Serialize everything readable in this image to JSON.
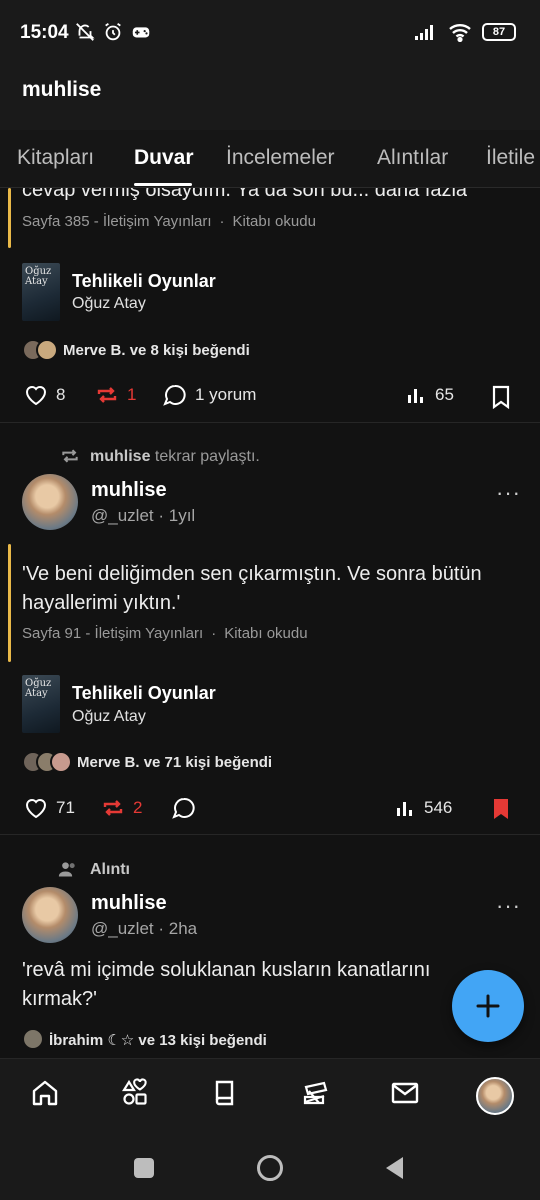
{
  "status_bar": {
    "time": "15:04",
    "battery": "87"
  },
  "app_bar": {
    "title": "muhlise"
  },
  "tabs": [
    {
      "label": "Kitapları"
    },
    {
      "label": "Duvar"
    },
    {
      "label": "İncelemeler"
    },
    {
      "label": "Alıntılar"
    },
    {
      "label": "İletile"
    }
  ],
  "posts": [
    {
      "quote_tail": "cevap vermiş olsaydım. Ya da son bu... daha fazla",
      "page_ref": "Sayfa 385 - İletişim Yayınları",
      "status": "Kitabı okudu",
      "book": {
        "title": "Tehlikeli Oyunlar",
        "author": "Oğuz Atay",
        "cover_line1": "Oğuz",
        "cover_line2": "Atay"
      },
      "likes_text": "Merve B. ve 8 kişi beğendi",
      "actions": {
        "likes": "8",
        "reposts": "1",
        "comments": "1 yorum",
        "views": "65"
      }
    },
    {
      "repost_user": "muhlise",
      "repost_label": "tekrar paylaştı.",
      "user": {
        "name": "muhlise",
        "handle": "@_uzlet",
        "time": "1yıl"
      },
      "quote": "'Ve beni deliğimden sen çıkarmıştın. Ve sonra bütün hayallerimi yıktın.'",
      "page_ref": "Sayfa 91 - İletişim Yayınları",
      "status": "Kitabı okudu",
      "book": {
        "title": "Tehlikeli Oyunlar",
        "author": "Oğuz Atay",
        "cover_line1": "Oğuz",
        "cover_line2": "Atay"
      },
      "likes_text": "Merve B. ve 71 kişi beğendi",
      "actions": {
        "likes": "71",
        "reposts": "2",
        "views": "546"
      }
    },
    {
      "type_label": "Alıntı",
      "user": {
        "name": "muhlise",
        "handle": "@_uzlet",
        "time": "2ha"
      },
      "quote": "'revâ mi içimde soluklanan kusların kanatlarını kırmak?'",
      "likes_text": "İbrahim ☾☆   ve 13 kişi beğendi"
    }
  ],
  "colors": {
    "accent_blue": "#42a5f5",
    "repost_red": "#e53935",
    "quote_bar": "#e9b949"
  },
  "bottom_nav": [
    "home-icon",
    "categories-icon",
    "book-icon",
    "book-stack-icon",
    "mail-icon",
    "profile-avatar"
  ]
}
